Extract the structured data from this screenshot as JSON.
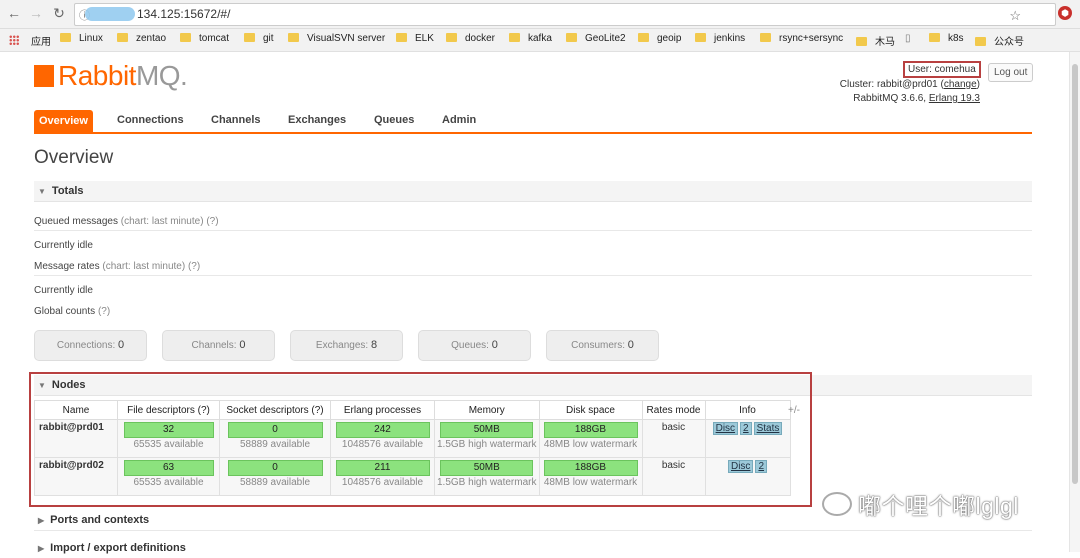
{
  "browser": {
    "url_visible": "134.125:15672/#/",
    "bookmarks": [
      "应用",
      "Linux",
      "zentao",
      "tomcat",
      "git",
      "VisualSVN server",
      "ELK",
      "docker",
      "kafka",
      "GeoLite2",
      "geoip",
      "jenkins",
      "rsync+sersync",
      "木马",
      "k8s",
      "公众号"
    ]
  },
  "header": {
    "logo_prefix": "Rabbit",
    "logo_suffix": "MQ.",
    "user_label": "User: comehua",
    "logout": "Log out",
    "cluster_prefix": "Cluster: rabbit@prd01 (",
    "cluster_change": "change",
    "cluster_suffix": ")",
    "version_prefix": "RabbitMQ 3.6.6, ",
    "version_erlang": "Erlang 19.3"
  },
  "tabs": [
    "Overview",
    "Connections",
    "Channels",
    "Exchanges",
    "Queues",
    "Admin"
  ],
  "page_title": "Overview",
  "totals": {
    "heading": "Totals",
    "queued": "Queued messages",
    "queued_hint": "(chart: last minute) (?)",
    "idle1": "Currently idle",
    "rates": "Message rates",
    "rates_hint": "(chart: last minute) (?)",
    "idle2": "Currently idle",
    "global": "Global counts",
    "global_hint": "(?)",
    "counts": [
      {
        "label": "Connections:",
        "value": "0"
      },
      {
        "label": "Channels:",
        "value": "0"
      },
      {
        "label": "Exchanges:",
        "value": "8"
      },
      {
        "label": "Queues:",
        "value": "0"
      },
      {
        "label": "Consumers:",
        "value": "0"
      }
    ]
  },
  "nodes": {
    "heading": "Nodes",
    "columns": [
      "Name",
      "File descriptors (?)",
      "Socket descriptors (?)",
      "Erlang processes",
      "Memory",
      "Disk space",
      "Rates mode",
      "Info"
    ],
    "plusminus": "+/-",
    "rows": [
      {
        "name": "rabbit@prd01",
        "fd": "32",
        "fd_sub": "65535 available",
        "sd": "0",
        "sd_sub": "58889 available",
        "ep": "242",
        "ep_sub": "1048576 available",
        "mem": "50MB",
        "mem_sub": "1.5GB high watermark",
        "disk": "188GB",
        "disk_sub": "48MB low watermark",
        "rates": "basic",
        "info": [
          "Disc",
          "2",
          "Stats"
        ]
      },
      {
        "name": "rabbit@prd02",
        "fd": "63",
        "fd_sub": "65535 available",
        "sd": "0",
        "sd_sub": "58889 available",
        "ep": "211",
        "ep_sub": "1048576 available",
        "mem": "50MB",
        "mem_sub": "1.5GB high watermark",
        "disk": "188GB",
        "disk_sub": "48MB low watermark",
        "rates": "basic",
        "info": [
          "Disc",
          "2"
        ]
      }
    ]
  },
  "sections": [
    "Ports and contexts",
    "Import / export definitions"
  ],
  "watermark": "嘟个哩个嘟lglgl",
  "colors": {
    "brand": "#ff6600",
    "bar": "#8ce27e",
    "highlight": "#b84040",
    "info_tag": "#9cc9d9"
  }
}
